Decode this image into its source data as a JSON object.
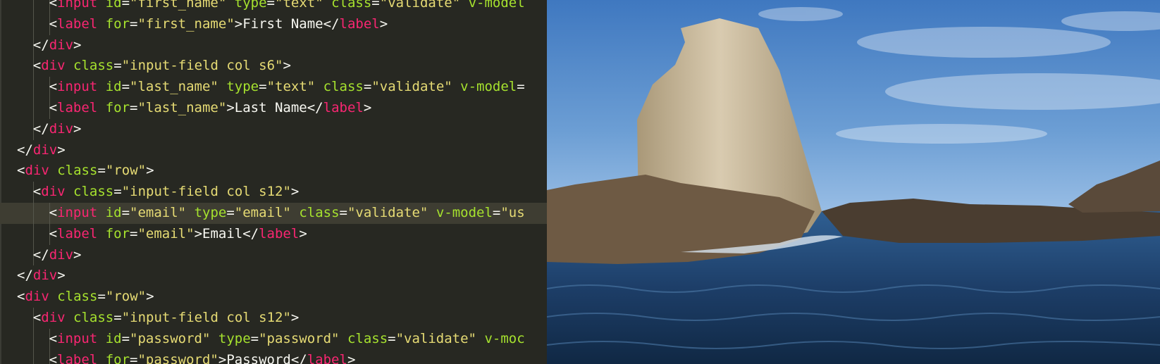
{
  "editor": {
    "highlighted_line": 10,
    "lines": [
      {
        "indent": 3,
        "tokens": [
          {
            "t": "punct",
            "v": "<"
          },
          {
            "t": "tag",
            "v": "input"
          },
          {
            "t": "text",
            "v": " "
          },
          {
            "t": "attr",
            "v": "id"
          },
          {
            "t": "punct",
            "v": "="
          },
          {
            "t": "str",
            "v": "\"first_name\""
          },
          {
            "t": "text",
            "v": " "
          },
          {
            "t": "attr",
            "v": "type"
          },
          {
            "t": "punct",
            "v": "="
          },
          {
            "t": "str",
            "v": "\"text\""
          },
          {
            "t": "text",
            "v": " "
          },
          {
            "t": "attr",
            "v": "class"
          },
          {
            "t": "punct",
            "v": "="
          },
          {
            "t": "str",
            "v": "\"validate\""
          },
          {
            "t": "text",
            "v": " "
          },
          {
            "t": "attr",
            "v": "v-model"
          }
        ]
      },
      {
        "indent": 3,
        "tokens": [
          {
            "t": "punct",
            "v": "<"
          },
          {
            "t": "tag",
            "v": "label"
          },
          {
            "t": "text",
            "v": " "
          },
          {
            "t": "attr",
            "v": "for"
          },
          {
            "t": "punct",
            "v": "="
          },
          {
            "t": "str",
            "v": "\"first_name\""
          },
          {
            "t": "punct",
            "v": ">"
          },
          {
            "t": "text",
            "v": "First Name"
          },
          {
            "t": "punct",
            "v": "</"
          },
          {
            "t": "tag",
            "v": "label"
          },
          {
            "t": "punct",
            "v": ">"
          }
        ]
      },
      {
        "indent": 2,
        "tokens": [
          {
            "t": "punct",
            "v": "</"
          },
          {
            "t": "tag",
            "v": "div"
          },
          {
            "t": "punct",
            "v": ">"
          }
        ]
      },
      {
        "indent": 2,
        "tokens": [
          {
            "t": "punct",
            "v": "<"
          },
          {
            "t": "tag",
            "v": "div"
          },
          {
            "t": "text",
            "v": " "
          },
          {
            "t": "attr",
            "v": "class"
          },
          {
            "t": "punct",
            "v": "="
          },
          {
            "t": "str",
            "v": "\"input-field col s6\""
          },
          {
            "t": "punct",
            "v": ">"
          }
        ]
      },
      {
        "indent": 3,
        "tokens": [
          {
            "t": "punct",
            "v": "<"
          },
          {
            "t": "tag",
            "v": "input"
          },
          {
            "t": "text",
            "v": " "
          },
          {
            "t": "attr",
            "v": "id"
          },
          {
            "t": "punct",
            "v": "="
          },
          {
            "t": "str",
            "v": "\"last_name\""
          },
          {
            "t": "text",
            "v": " "
          },
          {
            "t": "attr",
            "v": "type"
          },
          {
            "t": "punct",
            "v": "="
          },
          {
            "t": "str",
            "v": "\"text\""
          },
          {
            "t": "text",
            "v": " "
          },
          {
            "t": "attr",
            "v": "class"
          },
          {
            "t": "punct",
            "v": "="
          },
          {
            "t": "str",
            "v": "\"validate\""
          },
          {
            "t": "text",
            "v": " "
          },
          {
            "t": "attr",
            "v": "v-model"
          },
          {
            "t": "punct",
            "v": "="
          }
        ]
      },
      {
        "indent": 3,
        "tokens": [
          {
            "t": "punct",
            "v": "<"
          },
          {
            "t": "tag",
            "v": "label"
          },
          {
            "t": "text",
            "v": " "
          },
          {
            "t": "attr",
            "v": "for"
          },
          {
            "t": "punct",
            "v": "="
          },
          {
            "t": "str",
            "v": "\"last_name\""
          },
          {
            "t": "punct",
            "v": ">"
          },
          {
            "t": "text",
            "v": "Last Name"
          },
          {
            "t": "punct",
            "v": "</"
          },
          {
            "t": "tag",
            "v": "label"
          },
          {
            "t": "punct",
            "v": ">"
          }
        ]
      },
      {
        "indent": 2,
        "tokens": [
          {
            "t": "punct",
            "v": "</"
          },
          {
            "t": "tag",
            "v": "div"
          },
          {
            "t": "punct",
            "v": ">"
          }
        ]
      },
      {
        "indent": 1,
        "tokens": [
          {
            "t": "punct",
            "v": "</"
          },
          {
            "t": "tag",
            "v": "div"
          },
          {
            "t": "punct",
            "v": ">"
          }
        ]
      },
      {
        "indent": 1,
        "tokens": [
          {
            "t": "punct",
            "v": "<"
          },
          {
            "t": "tag",
            "v": "div"
          },
          {
            "t": "text",
            "v": " "
          },
          {
            "t": "attr",
            "v": "class"
          },
          {
            "t": "punct",
            "v": "="
          },
          {
            "t": "str",
            "v": "\"row\""
          },
          {
            "t": "punct",
            "v": ">"
          }
        ]
      },
      {
        "indent": 2,
        "tokens": [
          {
            "t": "punct",
            "v": "<"
          },
          {
            "t": "tag",
            "v": "div"
          },
          {
            "t": "text",
            "v": " "
          },
          {
            "t": "attr",
            "v": "class"
          },
          {
            "t": "punct",
            "v": "="
          },
          {
            "t": "str",
            "v": "\"input-field col s12\""
          },
          {
            "t": "punct",
            "v": ">"
          }
        ]
      },
      {
        "indent": 3,
        "tokens": [
          {
            "t": "punct",
            "v": "<"
          },
          {
            "t": "tag",
            "v": "input"
          },
          {
            "t": "text",
            "v": " "
          },
          {
            "t": "attr",
            "v": "id"
          },
          {
            "t": "punct",
            "v": "="
          },
          {
            "t": "str",
            "v": "\"email\""
          },
          {
            "t": "text",
            "v": " "
          },
          {
            "t": "attr",
            "v": "type"
          },
          {
            "t": "punct",
            "v": "="
          },
          {
            "t": "str",
            "v": "\"email\""
          },
          {
            "t": "text",
            "v": " "
          },
          {
            "t": "attr",
            "v": "class"
          },
          {
            "t": "punct",
            "v": "="
          },
          {
            "t": "str",
            "v": "\"validate\""
          },
          {
            "t": "text",
            "v": " "
          },
          {
            "t": "attr",
            "v": "v-model"
          },
          {
            "t": "punct",
            "v": "="
          },
          {
            "t": "str",
            "v": "\"us"
          }
        ]
      },
      {
        "indent": 3,
        "tokens": [
          {
            "t": "punct",
            "v": "<"
          },
          {
            "t": "tag",
            "v": "label"
          },
          {
            "t": "text",
            "v": " "
          },
          {
            "t": "attr",
            "v": "for"
          },
          {
            "t": "punct",
            "v": "="
          },
          {
            "t": "str",
            "v": "\"email\""
          },
          {
            "t": "punct",
            "v": ">"
          },
          {
            "t": "text",
            "v": "Email"
          },
          {
            "t": "punct",
            "v": "</"
          },
          {
            "t": "tag",
            "v": "label"
          },
          {
            "t": "punct",
            "v": ">"
          }
        ]
      },
      {
        "indent": 2,
        "tokens": [
          {
            "t": "punct",
            "v": "</"
          },
          {
            "t": "tag",
            "v": "div"
          },
          {
            "t": "punct",
            "v": ">"
          }
        ]
      },
      {
        "indent": 1,
        "tokens": [
          {
            "t": "punct",
            "v": "</"
          },
          {
            "t": "tag",
            "v": "div"
          },
          {
            "t": "punct",
            "v": ">"
          }
        ]
      },
      {
        "indent": 1,
        "tokens": [
          {
            "t": "punct",
            "v": "<"
          },
          {
            "t": "tag",
            "v": "div"
          },
          {
            "t": "text",
            "v": " "
          },
          {
            "t": "attr",
            "v": "class"
          },
          {
            "t": "punct",
            "v": "="
          },
          {
            "t": "str",
            "v": "\"row\""
          },
          {
            "t": "punct",
            "v": ">"
          }
        ]
      },
      {
        "indent": 2,
        "tokens": [
          {
            "t": "punct",
            "v": "<"
          },
          {
            "t": "tag",
            "v": "div"
          },
          {
            "t": "text",
            "v": " "
          },
          {
            "t": "attr",
            "v": "class"
          },
          {
            "t": "punct",
            "v": "="
          },
          {
            "t": "str",
            "v": "\"input-field col s12\""
          },
          {
            "t": "punct",
            "v": ">"
          }
        ]
      },
      {
        "indent": 3,
        "tokens": [
          {
            "t": "punct",
            "v": "<"
          },
          {
            "t": "tag",
            "v": "input"
          },
          {
            "t": "text",
            "v": " "
          },
          {
            "t": "attr",
            "v": "id"
          },
          {
            "t": "punct",
            "v": "="
          },
          {
            "t": "str",
            "v": "\"password\""
          },
          {
            "t": "text",
            "v": " "
          },
          {
            "t": "attr",
            "v": "type"
          },
          {
            "t": "punct",
            "v": "="
          },
          {
            "t": "str",
            "v": "\"password\""
          },
          {
            "t": "text",
            "v": " "
          },
          {
            "t": "attr",
            "v": "class"
          },
          {
            "t": "punct",
            "v": "="
          },
          {
            "t": "str",
            "v": "\"validate\""
          },
          {
            "t": "text",
            "v": " "
          },
          {
            "t": "attr",
            "v": "v-moc"
          }
        ]
      },
      {
        "indent": 3,
        "tokens": [
          {
            "t": "punct",
            "v": "<"
          },
          {
            "t": "tag",
            "v": "label"
          },
          {
            "t": "text",
            "v": " "
          },
          {
            "t": "attr",
            "v": "for"
          },
          {
            "t": "punct",
            "v": "="
          },
          {
            "t": "str",
            "v": "\"password\""
          },
          {
            "t": "punct",
            "v": ">"
          },
          {
            "t": "text",
            "v": "Password"
          },
          {
            "t": "punct",
            "v": "</"
          },
          {
            "t": "tag",
            "v": "label"
          },
          {
            "t": "punct",
            "v": ">"
          }
        ]
      }
    ]
  },
  "colors": {
    "editor_bg": "#272822",
    "tag": "#f92672",
    "attr": "#a6e22e",
    "string": "#e6db74",
    "text": "#f8f8f2",
    "sky": "#5e8fc6",
    "sea": "#1f3f66",
    "rock": "#c8b89a"
  }
}
